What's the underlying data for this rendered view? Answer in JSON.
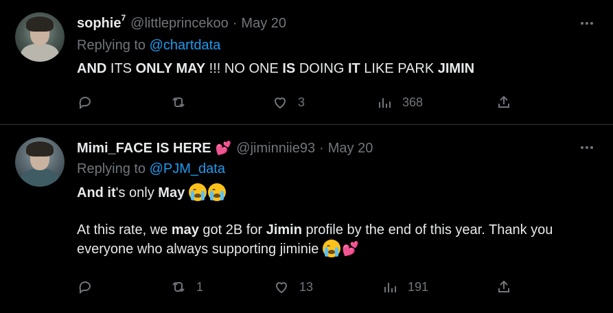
{
  "tweets": [
    {
      "display_name": "sophie",
      "superscript": "7",
      "handle": "@littleprincekoo",
      "dot": "·",
      "date": "May 20",
      "replying_prefix": "Replying to ",
      "replying_to": "@chartdata",
      "text_parts": [
        "AND",
        " ITS ",
        "ONLY MAY",
        " !!! NO ONE ",
        "IS",
        " DOING ",
        "IT",
        " LIKE PARK ",
        "JIMIN"
      ],
      "actions": {
        "reply": "",
        "retweet": "",
        "like": "3",
        "views": "368"
      }
    },
    {
      "display_name": "Mimi_FACE IS HERE",
      "name_emoji": "💕",
      "handle": "@jiminniie93",
      "dot": "·",
      "date": "May 20",
      "replying_prefix": "Replying to ",
      "replying_to": "@PJM_data",
      "line1_parts": [
        "And it",
        "'s ",
        "only",
        " ",
        "May"
      ],
      "para2_parts": [
        "At this rate, we ",
        "may",
        " got 2B for ",
        "Jimin",
        " profile by the end of this year. Thank you everyone who always supporting jiminie "
      ],
      "trailing_emoji": "💕",
      "actions": {
        "reply": "",
        "retweet": "1",
        "like": "13",
        "views": "191"
      }
    }
  ],
  "icons": {
    "more": "more-icon",
    "reply": "reply-icon",
    "retweet": "retweet-icon",
    "like": "heart-icon",
    "views": "views-icon",
    "share": "share-icon",
    "emoji": "loudly-crying-face-emoji"
  },
  "colors": {
    "background": "#000000",
    "text": "#e7e9ea",
    "muted": "#71767b",
    "link": "#1d9bf0",
    "divider": "#2f3336"
  }
}
